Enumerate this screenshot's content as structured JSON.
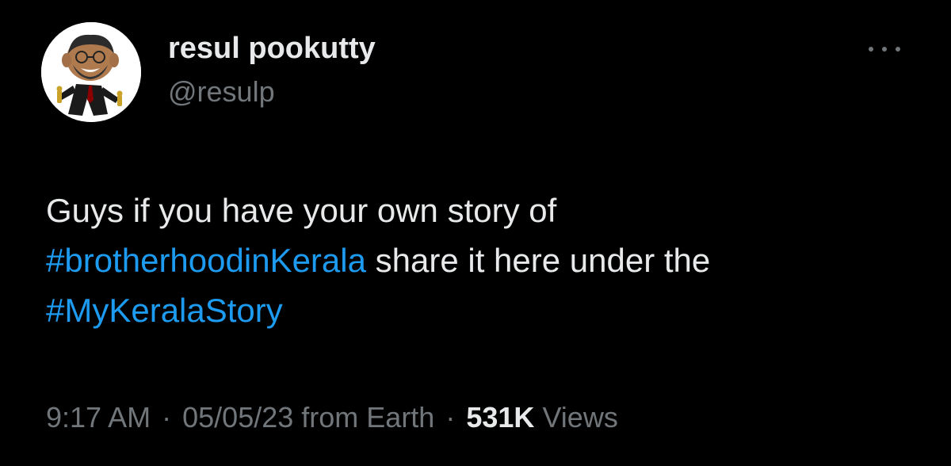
{
  "author": {
    "name": "resul pookutty",
    "handle": "@resulp",
    "avatar_icon": "caricature-avatar"
  },
  "menu": {
    "more_icon": "more-horizontal-icon"
  },
  "tweet": {
    "line1": "Guys if you have your own story of",
    "hashtag1": "#brotherhoodinKerala",
    "line2_rest": " share it here under the",
    "hashtag2": "#MyKeralaStory"
  },
  "meta": {
    "time": "9:17 AM",
    "separator": "·",
    "date": "05/05/23",
    "source": "from Earth",
    "views_count": "531K",
    "views_label": "Views"
  },
  "colors": {
    "background": "#000000",
    "text": "#e7e9ea",
    "secondary": "#71767b",
    "accent": "#1d9bf0"
  }
}
